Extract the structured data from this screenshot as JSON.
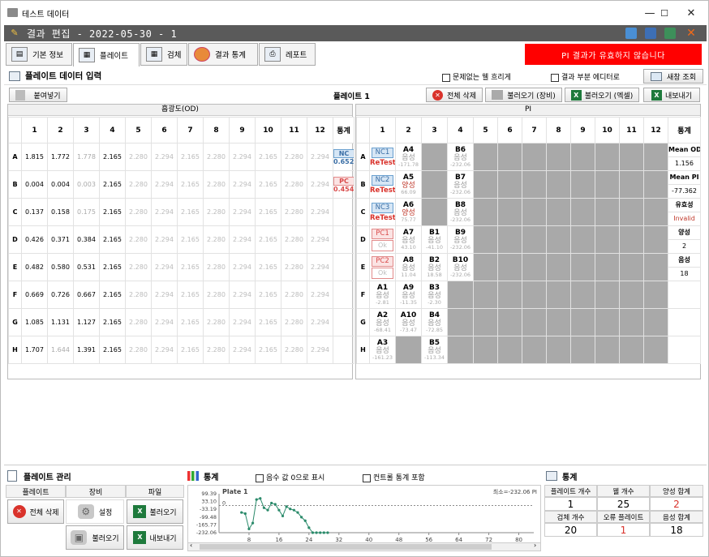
{
  "window": {
    "title": "테스트 데이터",
    "minimize": "—",
    "maximize": "☐",
    "close": "✕"
  },
  "header": {
    "title": "결과 편집 - 2022-05-30 - 1"
  },
  "tabs": [
    {
      "label": "기본 정보"
    },
    {
      "label": "플레이트"
    },
    {
      "label": "검체"
    },
    {
      "label": "결과 통계"
    },
    {
      "label": "레포트"
    }
  ],
  "alert": "PI 결과가 유효하지 않습니다",
  "section": {
    "title": "플레이트 데이터 입력",
    "opt_blur": "문제없는 웰 흐리게",
    "opt_editor": "결과 부분 에디터로",
    "refresh": "새창 조회"
  },
  "toolbar": {
    "paste": "붙여넣기",
    "plate_name": "플레이트 1",
    "delete_all": "전체 삭제",
    "load_device": "불러오기 (장비)",
    "load_excel": "불러오기 (엑셀)",
    "export": "내보내기"
  },
  "od": {
    "title": "흡광도(OD)",
    "cols": [
      "1",
      "2",
      "3",
      "4",
      "5",
      "6",
      "7",
      "8",
      "9",
      "10",
      "11",
      "12",
      "통계"
    ],
    "rows": [
      {
        "r": "A",
        "v": [
          "1.815",
          "1.772",
          "1.778",
          "2.165",
          "2.280",
          "2.294",
          "2.165",
          "2.280",
          "2.294",
          "2.165",
          "2.280",
          "2.294"
        ],
        "s": "NC",
        "sv": "0.652"
      },
      {
        "r": "B",
        "v": [
          "0.004",
          "0.004",
          "0.003",
          "2.165",
          "2.280",
          "2.294",
          "2.165",
          "2.280",
          "2.294",
          "2.165",
          "2.280",
          "2.294"
        ],
        "s": "PC",
        "sv": "0.454"
      },
      {
        "r": "C",
        "v": [
          "0.137",
          "0.158",
          "0.175",
          "2.165",
          "2.280",
          "2.294",
          "2.165",
          "2.280",
          "2.294",
          "2.165",
          "2.280",
          "2.294"
        ]
      },
      {
        "r": "D",
        "v": [
          "0.426",
          "0.371",
          "0.384",
          "2.165",
          "2.280",
          "2.294",
          "2.165",
          "2.280",
          "2.294",
          "2.165",
          "2.280",
          "2.294"
        ]
      },
      {
        "r": "E",
        "v": [
          "0.482",
          "0.580",
          "0.531",
          "2.165",
          "2.280",
          "2.294",
          "2.165",
          "2.280",
          "2.294",
          "2.165",
          "2.280",
          "2.294"
        ]
      },
      {
        "r": "F",
        "v": [
          "0.669",
          "0.726",
          "0.667",
          "2.165",
          "2.280",
          "2.294",
          "2.165",
          "2.280",
          "2.294",
          "2.165",
          "2.280",
          "2.294"
        ]
      },
      {
        "r": "G",
        "v": [
          "1.085",
          "1.131",
          "1.127",
          "2.165",
          "2.280",
          "2.294",
          "2.165",
          "2.280",
          "2.294",
          "2.165",
          "2.280",
          "2.294"
        ]
      },
      {
        "r": "H",
        "v": [
          "1.707",
          "1.644",
          "1.391",
          "2.165",
          "2.280",
          "2.294",
          "2.165",
          "2.280",
          "2.294",
          "2.165",
          "2.280",
          "2.294"
        ]
      }
    ]
  },
  "pi": {
    "title": "PI",
    "cols": [
      "1",
      "2",
      "3",
      "4",
      "5",
      "6",
      "7",
      "8",
      "9",
      "10",
      "11",
      "12",
      "통계"
    ],
    "rows": [
      {
        "r": "A",
        "c1": {
          "ctl": "NC1",
          "st": "ReTest"
        },
        "c2": {
          "n": "A4",
          "res": "음성",
          "pv": "-171.78"
        },
        "c3": null,
        "c4": {
          "n": "B6",
          "res": "음성",
          "pv": "-232.06"
        },
        "sl": "Mean OD",
        "sv": "1.156"
      },
      {
        "r": "B",
        "c1": {
          "ctl": "NC2",
          "st": "ReTest"
        },
        "c2": {
          "n": "A5",
          "res": "양성",
          "pv": "66.09"
        },
        "c3": null,
        "c4": {
          "n": "B7",
          "res": "음성",
          "pv": "-232.06"
        },
        "sl": "Mean PI",
        "sv": "-77.362"
      },
      {
        "r": "C",
        "c1": {
          "ctl": "NC3",
          "st": "ReTest"
        },
        "c2": {
          "n": "A6",
          "res": "양성",
          "pv": "75.77"
        },
        "c3": null,
        "c4": {
          "n": "B8",
          "res": "음성",
          "pv": "-232.06"
        },
        "sl": "유효성",
        "sv": "Invalid"
      },
      {
        "r": "D",
        "c1": {
          "ctl": "PC1",
          "st": "Ok"
        },
        "c2": {
          "n": "A7",
          "res": "음성",
          "pv": "43.10"
        },
        "c3": {
          "n": "B1",
          "res": "음성",
          "pv": "-41.10"
        },
        "c4": {
          "n": "B9",
          "res": "음성",
          "pv": "-232.06"
        },
        "sl": "양성",
        "sv": "2"
      },
      {
        "r": "E",
        "c1": {
          "ctl": "PC2",
          "st": "Ok"
        },
        "c2": {
          "n": "A8",
          "res": "음성",
          "pv": "11.04"
        },
        "c3": {
          "n": "B2",
          "res": "음성",
          "pv": "18.58"
        },
        "c4": {
          "n": "B10",
          "res": "음성",
          "pv": "-232.06"
        },
        "sl": "음성",
        "sv": "18"
      },
      {
        "r": "F",
        "c1": {
          "n": "A1",
          "res": "음성",
          "pv": "-2.81"
        },
        "c2": {
          "n": "A9",
          "res": "음성",
          "pv": "-11.35"
        },
        "c3": {
          "n": "B3",
          "res": "음성",
          "pv": "-2.30"
        },
        "c4": null
      },
      {
        "r": "G",
        "c1": {
          "n": "A2",
          "res": "음성",
          "pv": "-68.41"
        },
        "c2": {
          "n": "A10",
          "res": "음성",
          "pv": "-73.47"
        },
        "c3": {
          "n": "B4",
          "res": "음성",
          "pv": "-72.85"
        },
        "c4": null
      },
      {
        "r": "H",
        "c1": {
          "n": "A3",
          "res": "음성",
          "pv": "-161.23"
        },
        "c2": null,
        "c3": {
          "n": "B5",
          "res": "음성",
          "pv": "-113.34"
        },
        "c4": null
      }
    ]
  },
  "plate_mgmt": {
    "title": "플레이트 관리",
    "h_plate": "플레이트",
    "h_device": "장비",
    "h_file": "파일",
    "delete_all": "전체 삭제",
    "settings": "설정",
    "load_excel": "불러오기",
    "load_device": "불러오기",
    "export": "내보내기"
  },
  "stats_chart": {
    "title": "통계",
    "opt_neg0": "음수 값 0으로 표시",
    "opt_ctrl": "컨트롤 통계 포함",
    "plate": "Plate 1",
    "min_label": "최소=-232.06 PI"
  },
  "chart_data": {
    "type": "line",
    "y_ticks": [
      "99.39",
      "33.10",
      "-33.19",
      "-99.48",
      "-165.77",
      "-232.06"
    ],
    "x_ticks": [
      "8",
      "16",
      "24",
      "32",
      "40",
      "48",
      "56",
      "64",
      "72",
      "80"
    ],
    "ref_line_label": "0",
    "ylim": [
      -232.06,
      99.39
    ],
    "xlim": [
      0,
      84
    ],
    "points": [
      [
        6,
        -60
      ],
      [
        7,
        -70
      ],
      [
        8,
        -200
      ],
      [
        9,
        -150
      ],
      [
        10,
        50
      ],
      [
        11,
        60
      ],
      [
        12,
        -20
      ],
      [
        13,
        -40
      ],
      [
        14,
        20
      ],
      [
        15,
        10
      ],
      [
        16,
        -40
      ],
      [
        17,
        -90
      ],
      [
        18,
        -10
      ],
      [
        19,
        -30
      ],
      [
        20,
        -40
      ],
      [
        21,
        -60
      ],
      [
        22,
        -100
      ],
      [
        23,
        -130
      ],
      [
        24,
        -190
      ],
      [
        25,
        -232.06
      ],
      [
        26,
        -232.06
      ],
      [
        27,
        -232.06
      ],
      [
        28,
        -232.06
      ],
      [
        29,
        -232.06
      ]
    ]
  },
  "stats": {
    "title": "통계",
    "labels": [
      "플레이트 개수",
      "웰 개수",
      "양성 합계",
      "검체 개수",
      "오류 플레이트",
      "음성 합계"
    ],
    "values": [
      "1",
      "25",
      "2",
      "20",
      "1",
      "18"
    ]
  }
}
